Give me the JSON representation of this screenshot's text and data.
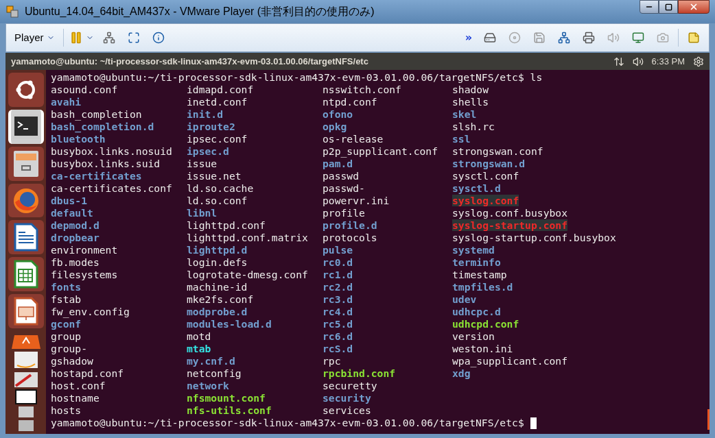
{
  "window": {
    "title": "Ubuntu_14.04_64bit_AM437x - VMware Player (非営利目的の使用のみ)"
  },
  "toolbar": {
    "player_menu": "Player",
    "overflow": "»"
  },
  "panel": {
    "title": "yamamoto@ubuntu: ~/ti-processor-sdk-linux-am437x-evm-03.01.00.06/targetNFS/etc",
    "clock": "6:33 PM"
  },
  "launcher": {
    "items": [
      {
        "kind": "ubuntu",
        "selected": false
      },
      {
        "kind": "terminal",
        "selected": true
      },
      {
        "kind": "files",
        "selected": false
      },
      {
        "kind": "firefox",
        "selected": false
      },
      {
        "kind": "writer",
        "selected": false
      },
      {
        "kind": "calc",
        "selected": false
      },
      {
        "kind": "impress",
        "selected": false
      },
      {
        "kind": "stack",
        "selected": false
      }
    ]
  },
  "terminal": {
    "command_line": "yamamoto@ubuntu:~/ti-processor-sdk-linux-am437x-evm-03.01.00.06/targetNFS/etc$ ls",
    "columns": [
      [
        {
          "name": "asound.conf",
          "kind": "file"
        },
        {
          "name": "avahi",
          "kind": "dir"
        },
        {
          "name": "bash_completion",
          "kind": "file"
        },
        {
          "name": "bash_completion.d",
          "kind": "dir"
        },
        {
          "name": "bluetooth",
          "kind": "dir"
        },
        {
          "name": "busybox.links.nosuid",
          "kind": "file"
        },
        {
          "name": "busybox.links.suid",
          "kind": "file"
        },
        {
          "name": "ca-certificates",
          "kind": "dir"
        },
        {
          "name": "ca-certificates.conf",
          "kind": "file"
        },
        {
          "name": "dbus-1",
          "kind": "dir"
        },
        {
          "name": "default",
          "kind": "dir"
        },
        {
          "name": "depmod.d",
          "kind": "dir"
        },
        {
          "name": "dropbear",
          "kind": "dir"
        },
        {
          "name": "environment",
          "kind": "file"
        },
        {
          "name": "fb.modes",
          "kind": "file"
        },
        {
          "name": "filesystems",
          "kind": "file"
        },
        {
          "name": "fonts",
          "kind": "dir"
        },
        {
          "name": "fstab",
          "kind": "file"
        },
        {
          "name": "fw_env.config",
          "kind": "file"
        },
        {
          "name": "gconf",
          "kind": "dir"
        },
        {
          "name": "group",
          "kind": "file"
        },
        {
          "name": "group-",
          "kind": "file"
        },
        {
          "name": "gshadow",
          "kind": "file"
        },
        {
          "name": "hostapd.conf",
          "kind": "file"
        },
        {
          "name": "host.conf",
          "kind": "file"
        },
        {
          "name": "hostname",
          "kind": "file"
        },
        {
          "name": "hosts",
          "kind": "file"
        }
      ],
      [
        {
          "name": "idmapd.conf",
          "kind": "file"
        },
        {
          "name": "inetd.conf",
          "kind": "file"
        },
        {
          "name": "init.d",
          "kind": "dir"
        },
        {
          "name": "iproute2",
          "kind": "dir"
        },
        {
          "name": "ipsec.conf",
          "kind": "file"
        },
        {
          "name": "ipsec.d",
          "kind": "dir"
        },
        {
          "name": "issue",
          "kind": "file"
        },
        {
          "name": "issue.net",
          "kind": "file"
        },
        {
          "name": "ld.so.cache",
          "kind": "file"
        },
        {
          "name": "ld.so.conf",
          "kind": "file"
        },
        {
          "name": "libnl",
          "kind": "dir"
        },
        {
          "name": "lighttpd.conf",
          "kind": "file"
        },
        {
          "name": "lighttpd.conf.matrix",
          "kind": "file"
        },
        {
          "name": "lighttpd.d",
          "kind": "dir"
        },
        {
          "name": "login.defs",
          "kind": "file"
        },
        {
          "name": "logrotate-dmesg.conf",
          "kind": "file"
        },
        {
          "name": "machine-id",
          "kind": "file"
        },
        {
          "name": "mke2fs.conf",
          "kind": "file"
        },
        {
          "name": "modprobe.d",
          "kind": "dir"
        },
        {
          "name": "modules-load.d",
          "kind": "dir"
        },
        {
          "name": "motd",
          "kind": "file"
        },
        {
          "name": "mtab",
          "kind": "link"
        },
        {
          "name": "my.cnf.d",
          "kind": "dir"
        },
        {
          "name": "netconfig",
          "kind": "file"
        },
        {
          "name": "network",
          "kind": "dir"
        },
        {
          "name": "nfsmount.conf",
          "kind": "exec"
        },
        {
          "name": "nfs-utils.conf",
          "kind": "exec"
        }
      ],
      [
        {
          "name": "nsswitch.conf",
          "kind": "file"
        },
        {
          "name": "ntpd.conf",
          "kind": "file"
        },
        {
          "name": "ofono",
          "kind": "dir"
        },
        {
          "name": "opkg",
          "kind": "dir"
        },
        {
          "name": "os-release",
          "kind": "file"
        },
        {
          "name": "p2p_supplicant.conf",
          "kind": "file"
        },
        {
          "name": "pam.d",
          "kind": "dir"
        },
        {
          "name": "passwd",
          "kind": "file"
        },
        {
          "name": "passwd-",
          "kind": "file"
        },
        {
          "name": "powervr.ini",
          "kind": "file"
        },
        {
          "name": "profile",
          "kind": "file"
        },
        {
          "name": "profile.d",
          "kind": "dir"
        },
        {
          "name": "protocols",
          "kind": "file"
        },
        {
          "name": "pulse",
          "kind": "dir"
        },
        {
          "name": "rc0.d",
          "kind": "dir"
        },
        {
          "name": "rc1.d",
          "kind": "dir"
        },
        {
          "name": "rc2.d",
          "kind": "dir"
        },
        {
          "name": "rc3.d",
          "kind": "dir"
        },
        {
          "name": "rc4.d",
          "kind": "dir"
        },
        {
          "name": "rc5.d",
          "kind": "dir"
        },
        {
          "name": "rc6.d",
          "kind": "dir"
        },
        {
          "name": "rcS.d",
          "kind": "dir"
        },
        {
          "name": "rpc",
          "kind": "file"
        },
        {
          "name": "rpcbind.conf",
          "kind": "exec"
        },
        {
          "name": "securetty",
          "kind": "file"
        },
        {
          "name": "security",
          "kind": "dir"
        },
        {
          "name": "services",
          "kind": "file"
        }
      ],
      [
        {
          "name": "shadow",
          "kind": "file"
        },
        {
          "name": "shells",
          "kind": "file"
        },
        {
          "name": "skel",
          "kind": "dir"
        },
        {
          "name": "slsh.rc",
          "kind": "file"
        },
        {
          "name": "ssl",
          "kind": "dir"
        },
        {
          "name": "strongswan.conf",
          "kind": "file"
        },
        {
          "name": "strongswan.d",
          "kind": "dir"
        },
        {
          "name": "sysctl.conf",
          "kind": "file"
        },
        {
          "name": "sysctl.d",
          "kind": "dir"
        },
        {
          "name": "syslog.conf",
          "kind": "broken"
        },
        {
          "name": "syslog.conf.busybox",
          "kind": "file"
        },
        {
          "name": "syslog-startup.conf",
          "kind": "broken"
        },
        {
          "name": "syslog-startup.conf.busybox",
          "kind": "file"
        },
        {
          "name": "systemd",
          "kind": "dir"
        },
        {
          "name": "terminfo",
          "kind": "dir"
        },
        {
          "name": "timestamp",
          "kind": "file"
        },
        {
          "name": "tmpfiles.d",
          "kind": "dir"
        },
        {
          "name": "udev",
          "kind": "dir"
        },
        {
          "name": "udhcpc.d",
          "kind": "dir"
        },
        {
          "name": "udhcpd.conf",
          "kind": "exec"
        },
        {
          "name": "version",
          "kind": "file"
        },
        {
          "name": "weston.ini",
          "kind": "file"
        },
        {
          "name": "wpa_supplicant.conf",
          "kind": "file"
        },
        {
          "name": "xdg",
          "kind": "dir"
        }
      ]
    ],
    "prompt": "yamamoto@ubuntu:~/ti-processor-sdk-linux-am437x-evm-03.01.00.06/targetNFS/etc$"
  }
}
